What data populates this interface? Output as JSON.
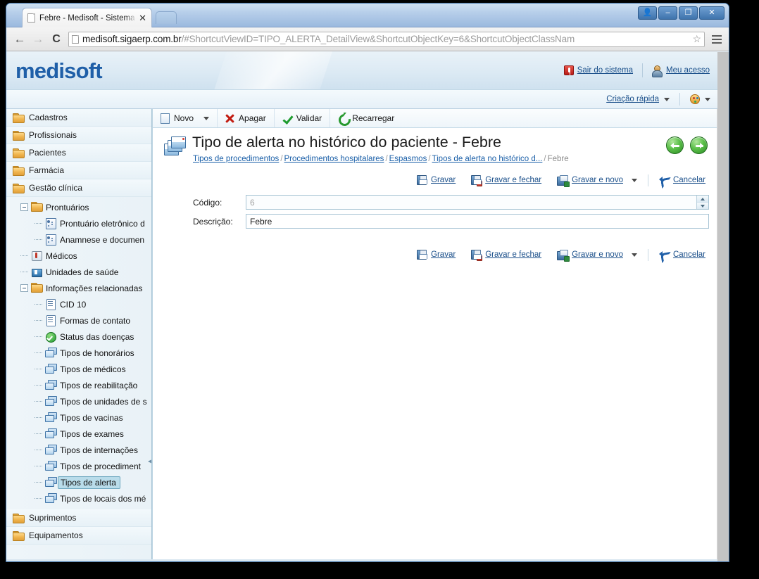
{
  "browser": {
    "tab_title": "Febre - Medisoft - Sistema de",
    "url_host": "medisoft.sigaerp.com.br",
    "url_rest": "/#ShortcutViewID=TIPO_ALERTA_DetailView&ShortcutObjectKey=6&ShortcutObjectClassNam",
    "back_icon": "back-arrow-icon",
    "forward_icon": "forward-arrow-icon",
    "reload_icon": "reload-icon",
    "star_icon": "bookmark-star-icon",
    "menu_icon": "hamburger-menu-icon",
    "window_controls": {
      "user": "user-icon",
      "minimize": "minimize-icon",
      "maximize": "maximize-icon",
      "close": "close-icon"
    }
  },
  "app_header": {
    "logo": "medisoft",
    "logo_color": "#1f5fa8",
    "links": [
      {
        "label": "Sair do sistema",
        "icon": "exit-key-icon"
      },
      {
        "label": "Meu acesso",
        "icon": "user-account-icon"
      }
    ]
  },
  "app_subbar": {
    "quick_create_label": "Criação rápida",
    "theme_icon": "palette-icon"
  },
  "sidebar": {
    "groups": [
      {
        "label": "Cadastros",
        "icon": "folder-icon"
      },
      {
        "label": "Profissionais",
        "icon": "folder-icon"
      },
      {
        "label": "Pacientes",
        "icon": "folder-icon"
      },
      {
        "label": "Farmácia",
        "icon": "folder-icon"
      },
      {
        "label": "Gestão clínica",
        "icon": "folder-icon"
      }
    ],
    "tree": [
      {
        "label": "Prontuários",
        "icon": "folder-icon",
        "level": 1,
        "expander": "minus",
        "selected": false
      },
      {
        "label": "Prontuário eletrônico d",
        "icon": "contact-card-icon",
        "level": 2,
        "expander": "line",
        "selected": false
      },
      {
        "label": "Anamnese e documen",
        "icon": "contact-card-icon",
        "level": 2,
        "expander": "line",
        "selected": false
      },
      {
        "label": "Médicos",
        "icon": "doctor-icon",
        "level": 1,
        "expander": "line",
        "selected": false
      },
      {
        "label": "Unidades de saúde",
        "icon": "hospital-icon",
        "level": 1,
        "expander": "line",
        "selected": false
      },
      {
        "label": "Informações relacionadas",
        "icon": "folder-icon",
        "level": 1,
        "expander": "minus",
        "selected": false
      },
      {
        "label": "CID 10",
        "icon": "document-icon",
        "level": 2,
        "expander": "line",
        "selected": false
      },
      {
        "label": "Formas de contato",
        "icon": "document-icon",
        "level": 2,
        "expander": "line",
        "selected": false
      },
      {
        "label": "Status das doenças",
        "icon": "green-check-icon",
        "level": 2,
        "expander": "line",
        "selected": false
      },
      {
        "label": "Tipos de honorários",
        "icon": "cards-icon",
        "level": 2,
        "expander": "line",
        "selected": false
      },
      {
        "label": "Tipos de médicos",
        "icon": "cards-icon",
        "level": 2,
        "expander": "line",
        "selected": false
      },
      {
        "label": "Tipos de reabilitação",
        "icon": "cards-icon",
        "level": 2,
        "expander": "line",
        "selected": false
      },
      {
        "label": "Tipos de unidades de s",
        "icon": "cards-icon",
        "level": 2,
        "expander": "line",
        "selected": false
      },
      {
        "label": "Tipos de vacinas",
        "icon": "cards-icon",
        "level": 2,
        "expander": "line",
        "selected": false
      },
      {
        "label": "Tipos de exames",
        "icon": "cards-icon",
        "level": 2,
        "expander": "line",
        "selected": false
      },
      {
        "label": "Tipos de internações",
        "icon": "cards-icon",
        "level": 2,
        "expander": "line",
        "selected": false
      },
      {
        "label": "Tipos de procediment",
        "icon": "cards-icon",
        "level": 2,
        "expander": "line",
        "selected": false
      },
      {
        "label": "Tipos de alerta",
        "icon": "cards-icon",
        "level": 2,
        "expander": "line",
        "selected": true
      },
      {
        "label": "Tipos de locais dos mé",
        "icon": "cards-icon",
        "level": 2,
        "expander": "line",
        "selected": false
      }
    ],
    "groups_bottom": [
      {
        "label": "Suprimentos",
        "icon": "folder-icon"
      },
      {
        "label": "Equipamentos",
        "icon": "folder-icon"
      }
    ],
    "selected_color": "#b9dcea"
  },
  "toolbar": {
    "buttons": [
      {
        "label": "Novo",
        "icon": "new-document-icon",
        "has_caret": true
      },
      {
        "label": "Apagar",
        "icon": "red-x-icon",
        "has_caret": false
      },
      {
        "label": "Validar",
        "icon": "green-check-icon",
        "has_caret": false
      },
      {
        "label": "Recarregar",
        "icon": "reload-icon",
        "has_caret": false
      }
    ]
  },
  "page": {
    "title": "Tipo de alerta no histórico do paciente - Febre",
    "title_icon": "stacked-cards-icon",
    "breadcrumb": [
      {
        "label": "Tipos de procedimentos",
        "link": true
      },
      {
        "label": "Procedimentos hospitalares",
        "link": true
      },
      {
        "label": "Espasmos",
        "link": true
      },
      {
        "label": "Tipos de alerta no histórico d...",
        "link": true
      },
      {
        "label": "Febre",
        "link": false
      }
    ],
    "nav_back_icon": "nav-back-circle-icon",
    "nav_forward_icon": "nav-forward-circle-icon"
  },
  "actions": [
    {
      "label": "Gravar",
      "icon": "save-icon",
      "has_caret": false
    },
    {
      "label": "Gravar e fechar",
      "icon": "save-close-icon",
      "has_caret": false
    },
    {
      "label": "Gravar e novo",
      "icon": "save-new-icon",
      "has_caret": true
    },
    {
      "label": "Cancelar",
      "icon": "undo-icon",
      "has_caret": false
    }
  ],
  "form": {
    "fields": [
      {
        "label": "Código:",
        "value": "6",
        "readonly": true,
        "spinner": true
      },
      {
        "label": "Descrição:",
        "value": "Febre",
        "readonly": false,
        "spinner": false
      }
    ]
  }
}
